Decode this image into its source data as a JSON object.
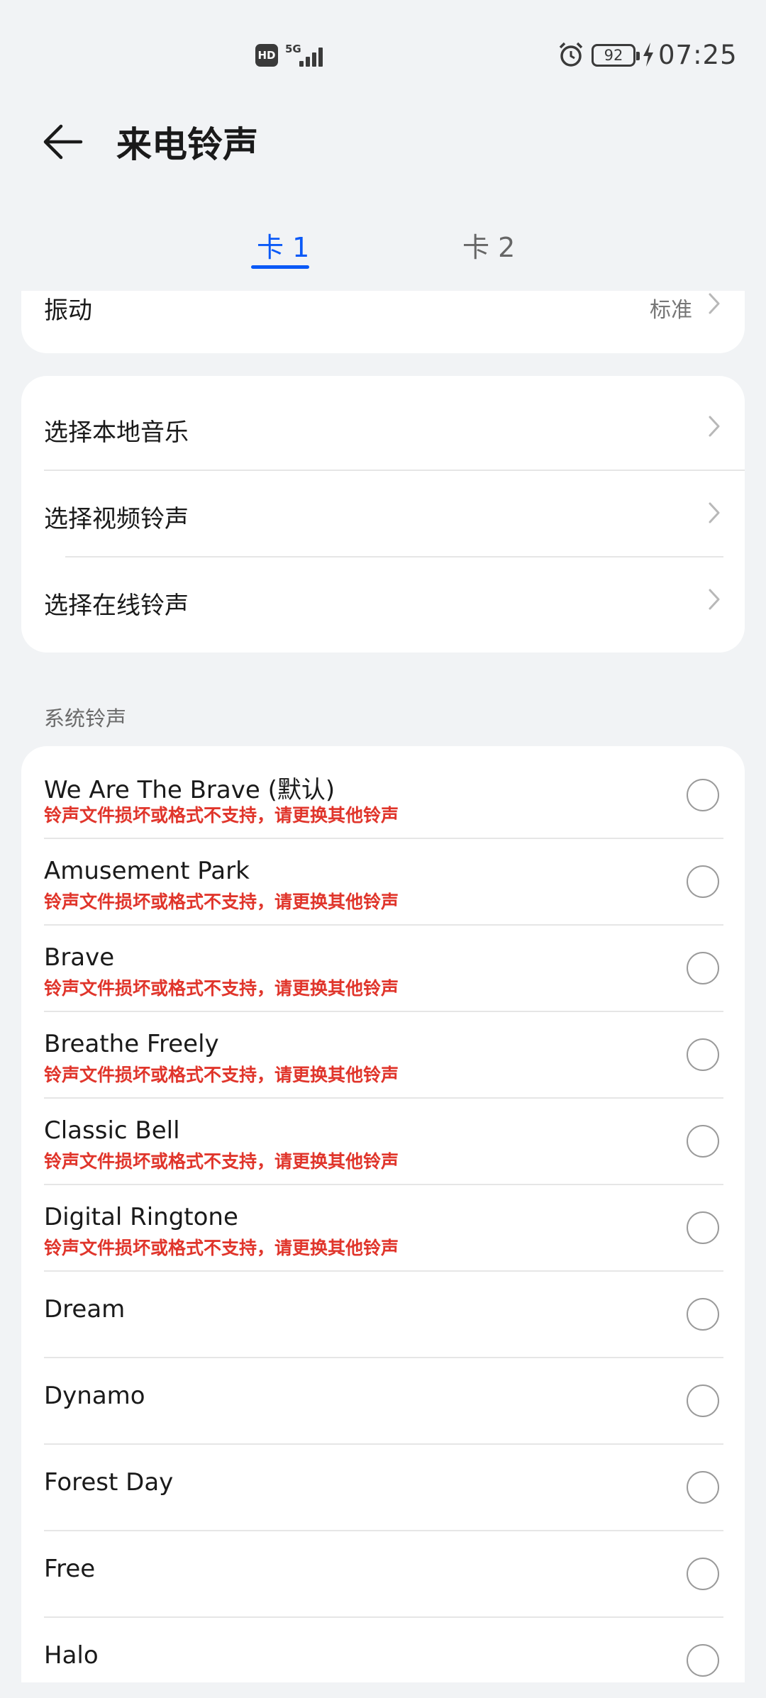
{
  "status_bar": {
    "hd_badge": "HD",
    "network_label": "5G",
    "battery_level": "92",
    "time": "07:25",
    "icons": [
      "hd-icon",
      "signal-icon",
      "alarm-icon",
      "battery-icon",
      "charging-icon"
    ]
  },
  "header": {
    "title": "来电铃声",
    "back_icon": "arrow-left-icon"
  },
  "tabs": [
    {
      "label": "卡 1",
      "active": true
    },
    {
      "label": "卡 2",
      "active": false
    }
  ],
  "vibration": {
    "label": "振动",
    "value": "标准"
  },
  "music_options": [
    {
      "label": "选择本地音乐"
    },
    {
      "label": "选择视频铃声"
    },
    {
      "label": "选择在线铃声"
    }
  ],
  "system_ringtones": {
    "section_title": "系统铃声",
    "items": [
      {
        "name": "We Are The Brave (默认)",
        "error": "铃声文件损坏或格式不支持，请更换其他铃声"
      },
      {
        "name": "Amusement Park",
        "error": "铃声文件损坏或格式不支持，请更换其他铃声"
      },
      {
        "name": "Brave",
        "error": "铃声文件损坏或格式不支持，请更换其他铃声"
      },
      {
        "name": "Breathe Freely",
        "error": "铃声文件损坏或格式不支持，请更换其他铃声"
      },
      {
        "name": "Classic Bell",
        "error": "铃声文件损坏或格式不支持，请更换其他铃声"
      },
      {
        "name": "Digital Ringtone",
        "error": "铃声文件损坏或格式不支持，请更换其他铃声"
      },
      {
        "name": "Dream"
      },
      {
        "name": "Dynamo"
      },
      {
        "name": "Forest Day"
      },
      {
        "name": "Free"
      },
      {
        "name": "Halo"
      }
    ]
  },
  "colors": {
    "accent": "#0a59f7",
    "error": "#e0352b",
    "background": "#f1f3f5",
    "card": "#ffffff"
  }
}
